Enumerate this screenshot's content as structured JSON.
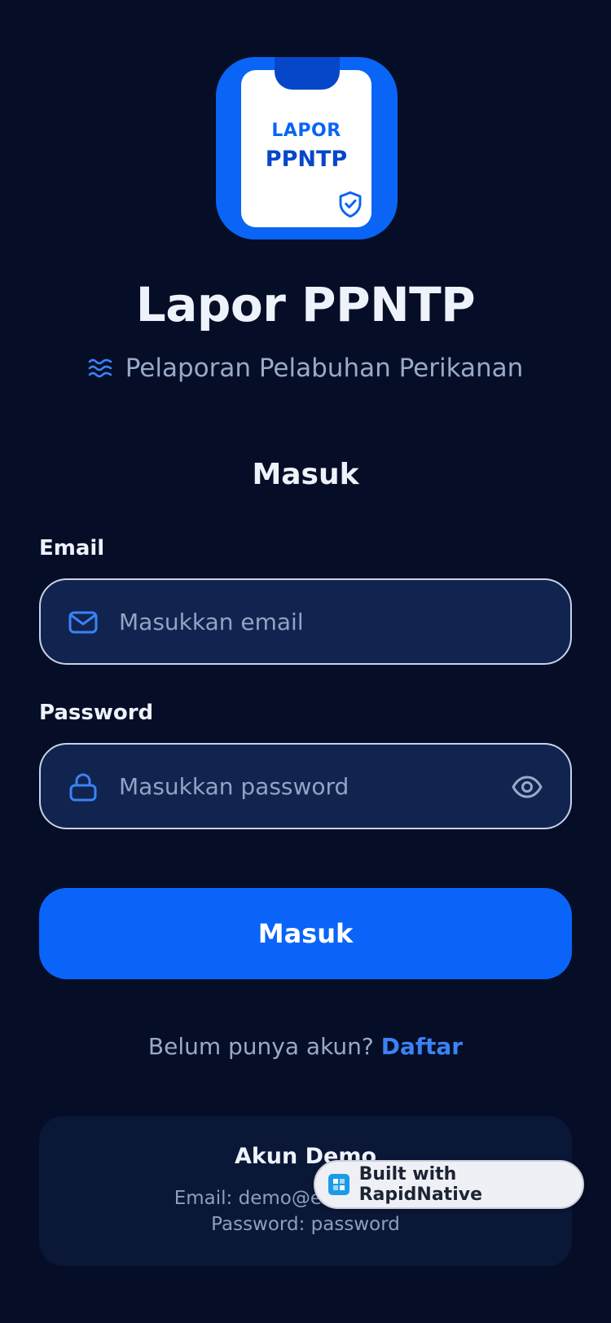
{
  "logo": {
    "line1": "LAPOR",
    "line2": "PPNTP"
  },
  "app": {
    "title": "Lapor PPNTP",
    "subtitle": "Pelaporan Pelabuhan Perikanan"
  },
  "form": {
    "heading": "Masuk",
    "email": {
      "label": "Email",
      "placeholder": "Masukkan email"
    },
    "password": {
      "label": "Password",
      "placeholder": "Masukkan password"
    },
    "submit_label": "Masuk"
  },
  "register": {
    "prompt": "Belum punya akun?",
    "link": "Daftar"
  },
  "demo": {
    "title": "Akun Demo",
    "email_line": "Email: demo@example.com",
    "password_line": "Password: password"
  },
  "badge": {
    "label": "Built with RapidNative"
  },
  "icons": {
    "logo": "clipboard-shield-icon",
    "subtitle": "waves-icon",
    "email": "mail-icon",
    "password": "lock-icon",
    "toggle": "eye-icon",
    "badge": "rapidnative-logo-icon"
  },
  "colors": {
    "background": "#050e26",
    "primary": "#0a64fa",
    "input_bg": "#112450",
    "link": "#3b82f6",
    "muted_text": "#9aa9c8"
  }
}
